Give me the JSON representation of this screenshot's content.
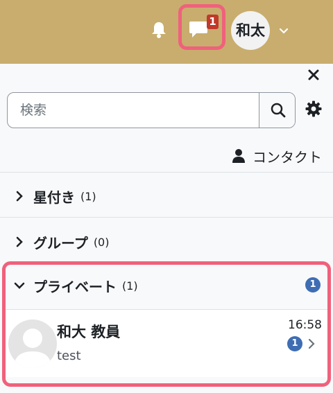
{
  "header": {
    "message_badge_count": "1",
    "user_avatar_initials": "和太"
  },
  "drawer": {
    "search_placeholder": "検索",
    "contacts_label": "コンタクト",
    "sections": [
      {
        "title": "星付き",
        "count": "(1)",
        "expanded": false
      },
      {
        "title": "グループ",
        "count": "(0)",
        "expanded": false
      },
      {
        "title": "プライベート",
        "count": "(1)",
        "expanded": true,
        "unread_badge": "1"
      }
    ],
    "conversations": [
      {
        "name": "和大 教員",
        "snippet": "test",
        "time": "16:58",
        "unread_badge": "1"
      }
    ]
  },
  "colors": {
    "topbar": "#c8ad6e",
    "highlight": "#f0617c",
    "badge_blue": "#3e6db3",
    "badge_red": "#c0392b"
  }
}
